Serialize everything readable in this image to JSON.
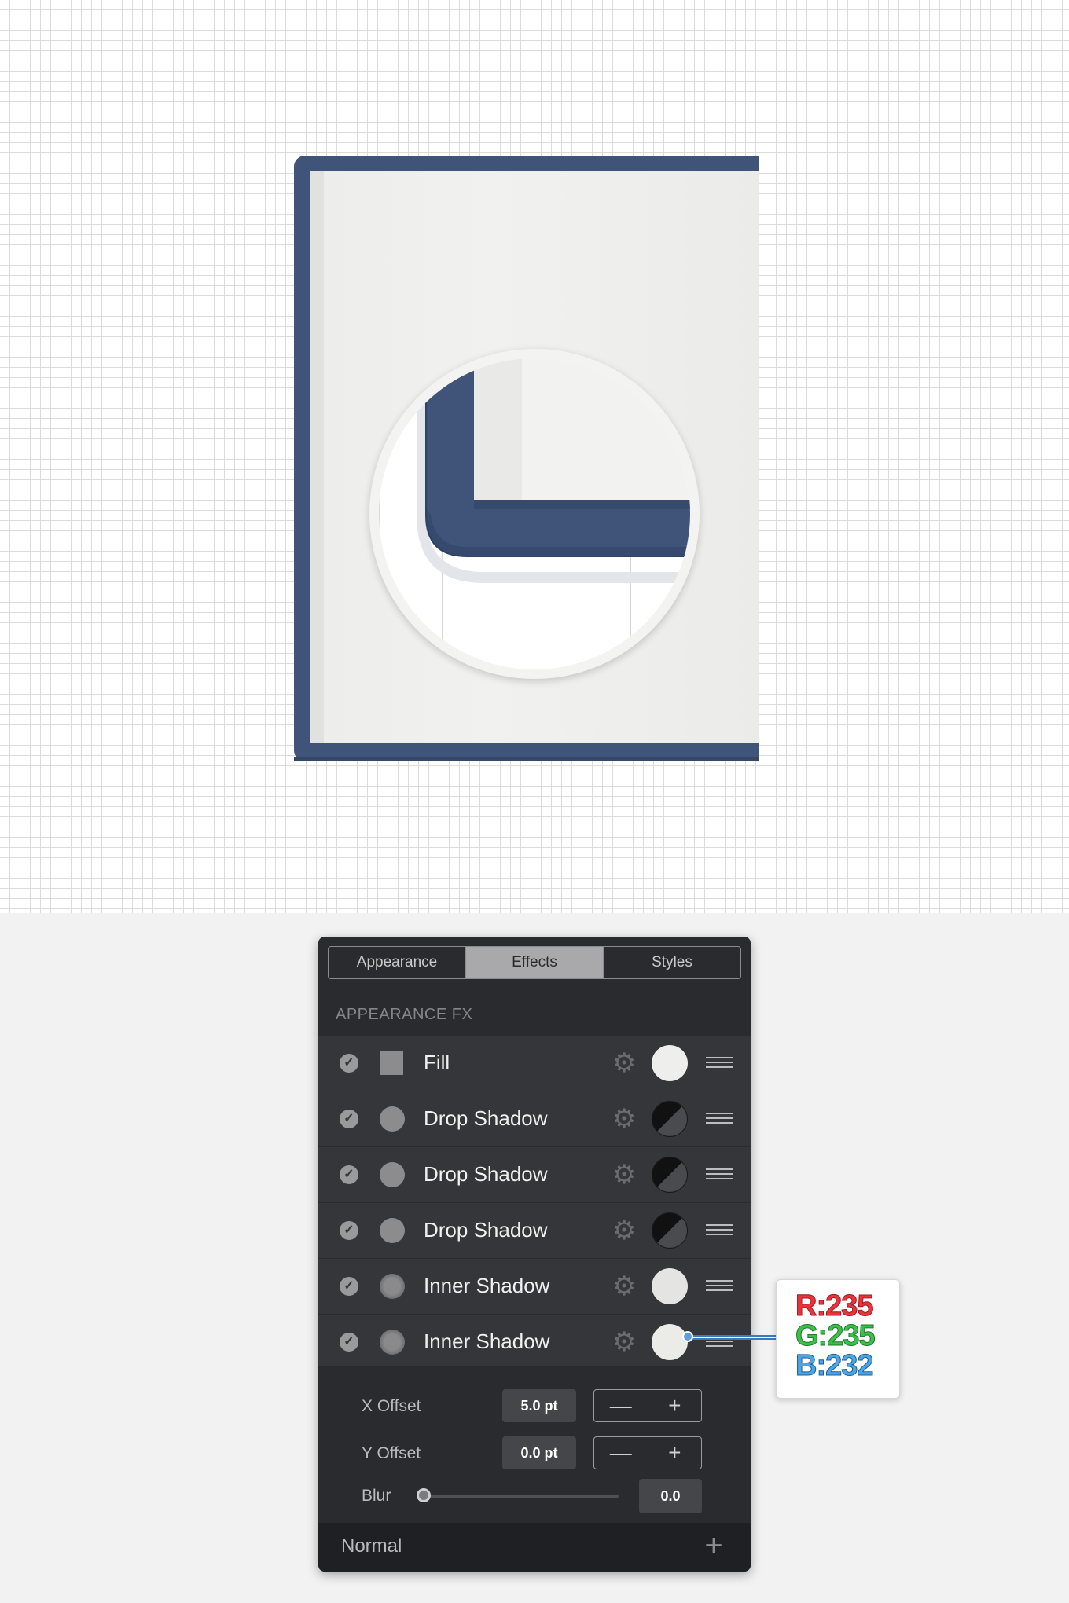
{
  "canvas": {
    "frame_color": "#3f5478",
    "paper_color": "#eeeeec"
  },
  "panel": {
    "tabs": [
      {
        "label": "Appearance",
        "active": false
      },
      {
        "label": "Effects",
        "active": true
      },
      {
        "label": "Styles",
        "active": false
      }
    ],
    "section_title": "APPEARANCE FX",
    "effects": [
      {
        "label": "Fill",
        "enabled": true,
        "swatch": "square",
        "color": "#eeeeec",
        "color_mode": "solid"
      },
      {
        "label": "Drop Shadow",
        "enabled": true,
        "swatch": "circle",
        "color_mode": "shadow"
      },
      {
        "label": "Drop Shadow",
        "enabled": true,
        "swatch": "circle",
        "color_mode": "shadow"
      },
      {
        "label": "Drop Shadow",
        "enabled": true,
        "swatch": "circle",
        "color_mode": "shadow"
      },
      {
        "label": "Inner Shadow",
        "enabled": true,
        "swatch": "circle-soft",
        "color": "#e4e4e2",
        "color_mode": "solid"
      },
      {
        "label": "Inner Shadow",
        "enabled": true,
        "swatch": "circle-soft",
        "color": "#ebebe8",
        "color_mode": "solid"
      }
    ],
    "settings": {
      "x_offset_label": "X Offset",
      "x_offset_value": "5.0 pt",
      "y_offset_label": "Y Offset",
      "y_offset_value": "0.0 pt",
      "blur_label": "Blur",
      "blur_value": "0.0",
      "blur_level": 0.0,
      "minus_glyph": "—",
      "plus_glyph": "+"
    },
    "blend_mode": "Normal",
    "add_glyph": "+",
    "check_glyph": "✓",
    "gear_glyph": "⚙"
  },
  "callout": {
    "r": "R:235",
    "g": "G:235",
    "b": "B:232"
  }
}
